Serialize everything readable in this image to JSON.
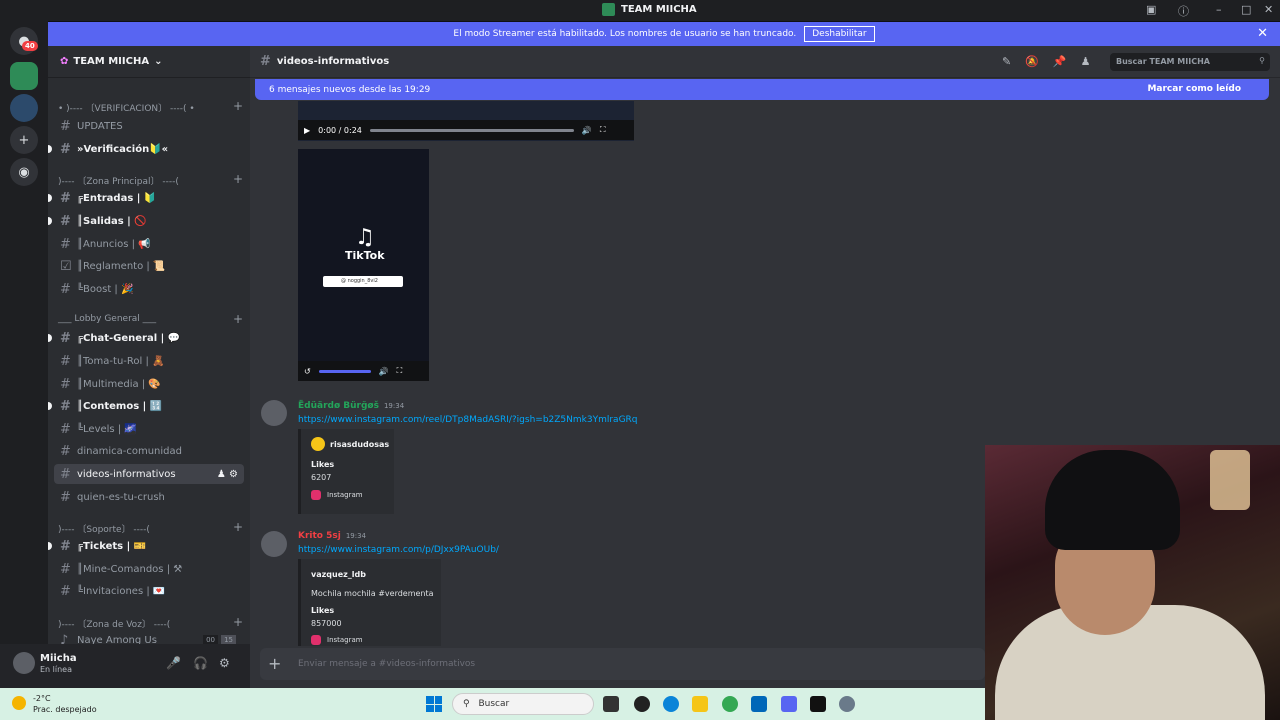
{
  "window": {
    "title": "TEAM MIICHA"
  },
  "banner": {
    "text": "El modo Streamer está habilitado. Los nombres de usuario se han truncado.",
    "button": "Deshabilitar"
  },
  "rail": {
    "badge": "40"
  },
  "server": {
    "name": "TEAM MIICHA"
  },
  "categories": [
    "• )---- 〔VERIFICACION〕 ----( •",
    ")---- 〔Zona Principal〕 ----(",
    "___ Lobby General ___",
    ")---- 〔Soporte〕 ----(",
    ")---- 〔Zona de Voz〕 ----("
  ],
  "channels": [
    "UPDATES",
    "»Verificación🔰«",
    "╔Entradas | 🔰",
    "║Salidas | 🚫",
    "║Anuncios | 📢",
    "║Reglamento | 📜",
    "╚Boost | 🎉",
    "╔Chat-General | 💬",
    "║Toma-tu-Rol | 🧸",
    "║Multimedia | 🎨",
    "║Contemos | 🔢",
    "╚Levels | 🌌",
    "dinamica-comunidad",
    "videos-informativos",
    "quien-es-tu-crush",
    "╔Tickets | 🎫",
    "║Mine-Comandos | ⚒",
    "╚Invitaciones | 💌",
    "Naye Among Us"
  ],
  "voice": {
    "badge1": "00",
    "badge2": "15"
  },
  "user": {
    "name": "Miicha",
    "status": "En línea"
  },
  "channel_header": {
    "name": "videos-informativos",
    "search_placeholder": "Buscar TEAM MIICHA"
  },
  "new_messages": {
    "text": "6 mensajes nuevos desde las 19:29",
    "action": "Marcar como leído"
  },
  "video": {
    "time": "0:00 / 0:24"
  },
  "tiktok": {
    "label": "TikTok",
    "handle": "@ noggin_8vi2"
  },
  "messages": [
    {
      "author": "Ëdüärdø Bürğøš",
      "time": "19:34",
      "link": "https://www.instagram.com/reel/DTp8MadASRI/?igsh=b2Z5Nmk3YmlraGRq",
      "embed": {
        "account": "risasdudosas",
        "field": "Likes",
        "value": "6207",
        "provider": "Instagram"
      }
    },
    {
      "author": "Krito 5sj",
      "time": "19:34",
      "link": "https://www.instagram.com/p/DJxx9PAuOUb/",
      "embed": {
        "account": "vazquez_ldb",
        "desc": "Mochila mochila #verdementa",
        "field": "Likes",
        "value": "857000",
        "provider": "Instagram"
      }
    }
  ],
  "composer": {
    "placeholder": "Enviar mensaje a #videos-informativos"
  },
  "taskbar": {
    "temp": "-2°C",
    "weather": "Prac. despejado",
    "search": "Buscar"
  },
  "colors": {
    "accent": "#5865f2",
    "link": "#00a8fc",
    "author1": "#23a55a",
    "author2": "#f23f43"
  }
}
